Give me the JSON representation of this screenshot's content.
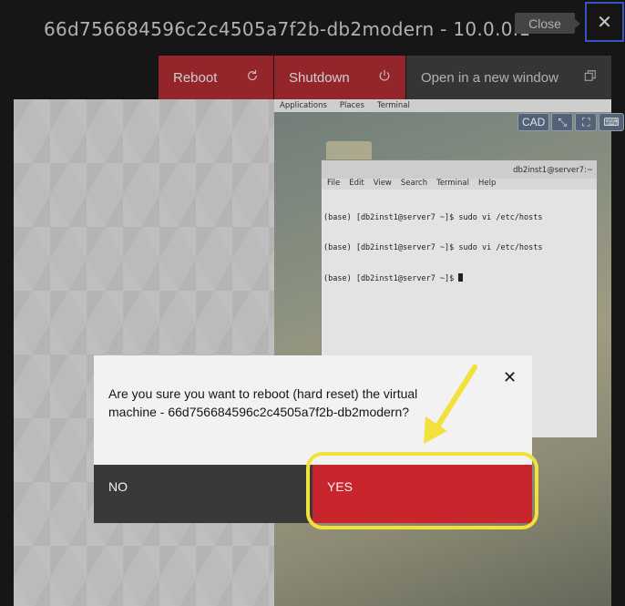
{
  "window": {
    "title": "66d756684596c2c4505a7f2b-db2modern - 10.0.0.1",
    "close_tooltip": "Close",
    "close_icon": "✕"
  },
  "toolbar": {
    "reboot_label": "Reboot",
    "shutdown_label": "Shutdown",
    "open_label": "Open in a new window"
  },
  "console": {
    "gnome_menu": [
      "Applications",
      "Places",
      "Terminal"
    ],
    "vnc_buttons": [
      "CAD",
      "⤡",
      "⛶",
      "⌨"
    ],
    "terminal_title": "db2inst1@server7:~",
    "terminal_menu": [
      "File",
      "Edit",
      "View",
      "Search",
      "Terminal",
      "Help"
    ],
    "terminal_lines": [
      "(base) [db2inst1@server7 ~]$ sudo vi /etc/hosts",
      "(base) [db2inst1@server7 ~]$ sudo vi /etc/hosts",
      "(base) [db2inst1@server7 ~]$ "
    ]
  },
  "dialog": {
    "message": "Are you sure you want to reboot (hard reset) the virtual machine - 66d756684596c2c4505a7f2b-db2modern?",
    "close_icon": "✕",
    "no_label": "NO",
    "yes_label": "YES"
  },
  "colors": {
    "danger": "#c9252c",
    "annotation": "#f2e13a"
  }
}
